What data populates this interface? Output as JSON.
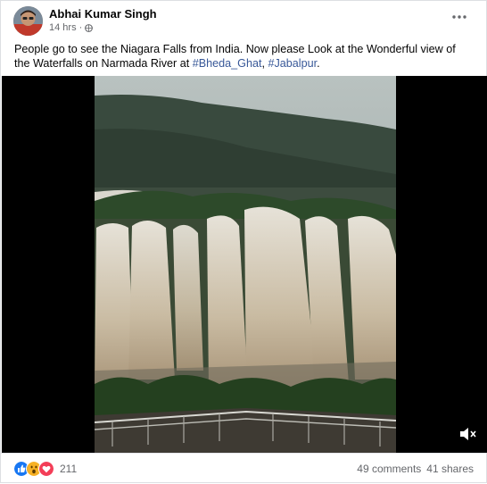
{
  "post": {
    "author": "Abhai Kumar Singh",
    "time": "14 hrs",
    "separator": "·",
    "text_before": "People go to see the Niagara Falls from India. Now please Look at the Wonderful view  of the Waterfalls on Narmada River at ",
    "hashtag1": "#Bheda_Ghat",
    "comma": ", ",
    "hashtag2": "#Jabalpur",
    "period": ".",
    "reaction_count": "211",
    "comments": "49 comments",
    "shares": "41 shares",
    "reactions": [
      "like",
      "wow",
      "love"
    ],
    "colors": {
      "like": "#1877f2",
      "wow": "#f7b125",
      "love": "#f33e58",
      "link": "#385898"
    }
  }
}
